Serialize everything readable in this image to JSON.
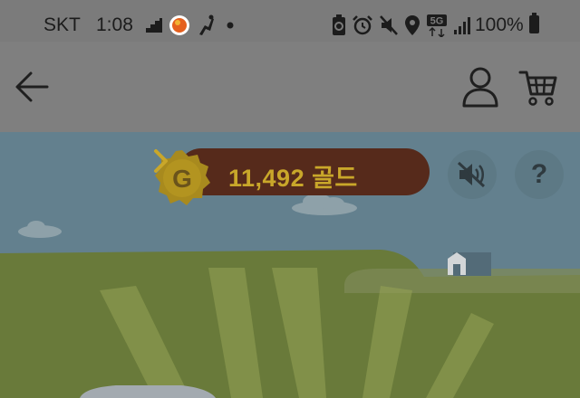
{
  "status_bar": {
    "carrier": "SKT",
    "time": "1:08",
    "battery": "100%",
    "network": "5G",
    "left_icons": [
      "stairs-icon",
      "app-notification-icon",
      "run-icon",
      "dot-icon"
    ],
    "right_icons": [
      "battery-saver-icon",
      "alarm-icon",
      "mute-icon",
      "location-icon",
      "5g-icon",
      "signal-icon"
    ]
  },
  "header": {
    "icons": [
      "back-arrow-icon",
      "user-icon",
      "cart-icon"
    ]
  },
  "game": {
    "gold_amount": "11,492 골드",
    "coin_letter": "G",
    "help_label": "?",
    "colors": {
      "pill": "#562a1b",
      "gold": "#c9a72a",
      "sky": "#63808e",
      "grass": "#697a3a",
      "overlay_button": "#5d7985"
    }
  }
}
